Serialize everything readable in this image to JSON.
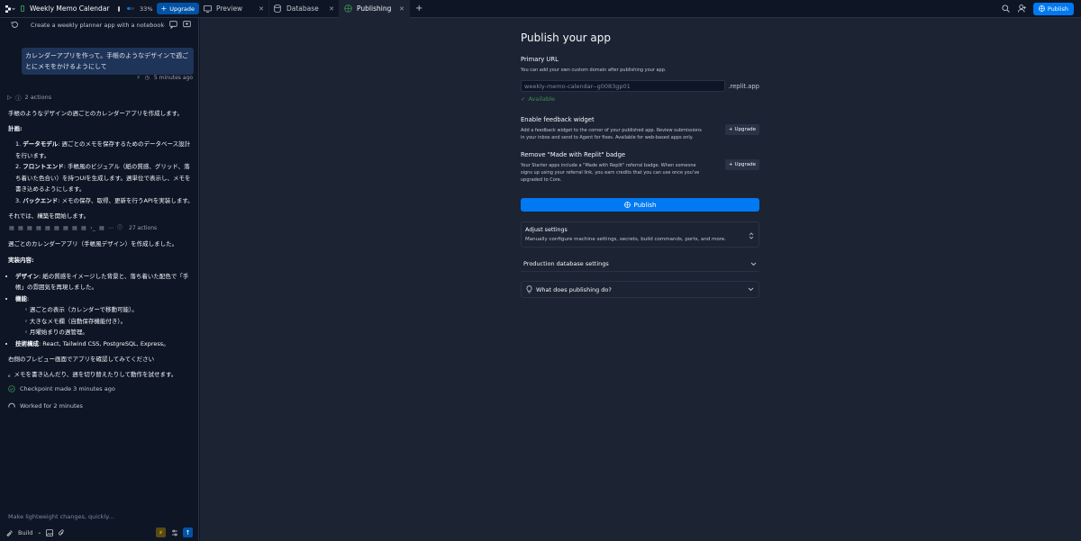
{
  "topbar": {
    "app_title": "Weekly Memo Calendar",
    "progress_percent": 33,
    "progress_label": "33%",
    "upgrade_label": "Upgrade",
    "tabs": [
      {
        "label": "Preview",
        "icon": "monitor-icon",
        "active": false
      },
      {
        "label": "Database",
        "icon": "database-icon",
        "active": false
      },
      {
        "label": "Publishing",
        "icon": "globe-icon",
        "active": true
      }
    ],
    "publish_label": "Publish"
  },
  "left_panel": {
    "header_title": "Create a weekly planner app with a notebook-s...",
    "user_message": "カレンダーアプリを作って。手帳のようなデザインで週ごとにメモをかけるようにして",
    "message_time": "5 minutes ago",
    "actions_count": "2 actions",
    "intro": "手帳のようなデザインの週ごとのカレンダーアプリを作成します。",
    "plan_heading": "計画:",
    "plan_items": [
      {
        "num": "1.",
        "title": "データモデル",
        "text": ": 週ごとのメモを保存するためのデータベース設計を行います。"
      },
      {
        "num": "2.",
        "title": "フロントエンド",
        "text": ": 手帳風のビジュアル（紙の質感、グリッド、落ち着いた色合い）を持つUIを生成します。週単位で表示し、メモを書き込めるようにします。"
      },
      {
        "num": "3.",
        "title": "バックエンド",
        "text": ": メモの保存、取得、更新を行うAPIを実装します。"
      }
    ],
    "start_text": "それでは、構築を開始します。",
    "actions2_count": "27 actions",
    "result_text": "週ごとのカレンダーアプリ（手帳風デザイン）を作成しました。",
    "impl_heading": "実装内容:",
    "impl_items": [
      {
        "title": "デザイン",
        "text": ": 紙の質感をイメージした背景と、落ち着いた配色で「手帳」の雰囲気を再現しました。"
      },
      {
        "title": "機能",
        "text": ":"
      }
    ],
    "feature_items": [
      "週ごとの表示（カレンダーで移動可能）。",
      "大きなメモ欄（自動保存機能付き）。",
      "月曜始まりの週管理。"
    ],
    "tech_title": "技術構成",
    "tech_text": ": React, Tailwind CSS, PostgreSQL, Express。",
    "preview_text": "右側のプレビュー画面でアプリを確認してみてください",
    "try_text": "。メモを書き込んだり、週を切り替えたりして動作を試せます。",
    "checkpoint_text": "Checkpoint made 3 minutes ago",
    "worked_text": "Worked for 2 minutes",
    "input_placeholder": "Make lightweight changes, quickly...",
    "mode_label": "Build"
  },
  "publish": {
    "heading": "Publish your app",
    "primary_url_title": "Primary URL",
    "primary_url_desc": "You can add your own custom domain after publishing your app.",
    "url_value": "weekly-memo-calendar--g0083gp01",
    "url_suffix": ".replit.app",
    "available_label": "Available",
    "feedback_title": "Enable feedback widget",
    "feedback_desc": "Add a feedback widget to the corner of your published app. Review submissions in your inbox and send to Agent for fixes. Available for web-based apps only.",
    "badge_title": "Remove \"Made with Replit\" badge",
    "badge_desc": "Your Starter apps include a \"Made with Replit\" referral badge. When someone signs up using your referral link, you earn credits that you can use once you've upgraded to Core.",
    "upgrade_label": "Upgrade",
    "publish_button": "Publish",
    "adjust_title": "Adjust settings",
    "adjust_desc": "Manually configure machine settings, secrets, build commands, ports, and more.",
    "db_settings_title": "Production database settings",
    "faq_title": "What does publishing do?"
  },
  "colors": {
    "accent": "#0079f2",
    "background": "#0e1525",
    "panel": "#1c2333",
    "success": "#3a8d4e"
  }
}
